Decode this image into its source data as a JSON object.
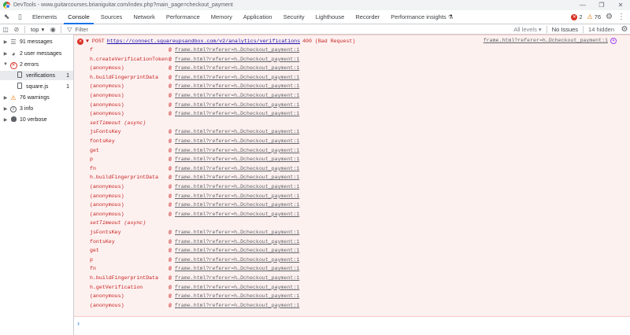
{
  "window": {
    "title": "DevTools - www.guitarcourses.brianiguitar.com/index.php?main_page=checkout_payment",
    "buttons": [
      "—",
      "❐",
      "✕"
    ]
  },
  "tabs": [
    "Elements",
    "Console",
    "Sources",
    "Network",
    "Performance",
    "Memory",
    "Application",
    "Security",
    "Lighthouse",
    "Recorder",
    "Performance insights"
  ],
  "active_tab": "Console",
  "badges": {
    "errors": "2",
    "warnings": "76"
  },
  "toolbar": {
    "context": "top",
    "filter_placeholder": "Filter",
    "levels": "All levels ▾",
    "issues": "No Issues",
    "hidden": "14 hidden"
  },
  "sidebar": {
    "items": [
      {
        "label": "91 messages",
        "num": ""
      },
      {
        "label": "2 user messages",
        "num": ""
      },
      {
        "label": "2 errors",
        "num": ""
      },
      {
        "label": "verifications",
        "num": "1"
      },
      {
        "label": "square.js",
        "num": "1"
      },
      {
        "label": "76 warnings",
        "num": ""
      },
      {
        "label": "3 info",
        "num": ""
      },
      {
        "label": "10 verbose",
        "num": ""
      }
    ]
  },
  "error": {
    "method": "▼ POST",
    "url": "https://connect.squareupsandbox.com/v2/analytics/verifications",
    "status": "400 (Bad Request)",
    "source": "frame.html?referer=h…Dcheckout_payment:1",
    "frames": [
      {
        "fn": "f",
        "loc": "frame.html?referer=h…Dcheckout_payment:1"
      },
      {
        "fn": "h.createVerificationToken",
        "loc": "frame.html?referer=h…Dcheckout_payment:1"
      },
      {
        "fn": "(anonymous)",
        "loc": "frame.html?referer=h…Dcheckout_payment:1"
      },
      {
        "fn": "h.buildFingerprintData",
        "loc": "frame.html?referer=h…Dcheckout_payment:1"
      },
      {
        "fn": "(anonymous)",
        "loc": "frame.html?referer=h…Dcheckout_payment:1"
      },
      {
        "fn": "(anonymous)",
        "loc": "frame.html?referer=h…Dcheckout_payment:1"
      },
      {
        "fn": "(anonymous)",
        "loc": "frame.html?referer=h…Dcheckout_payment:1"
      },
      {
        "fn": "(anonymous)",
        "loc": "frame.html?referer=h…Dcheckout_payment:1"
      },
      {
        "fn": "setTimeout (async)",
        "loc": "",
        "async": true
      },
      {
        "fn": "jsFontsKey",
        "loc": "frame.html?referer=h…Dcheckout_payment:1"
      },
      {
        "fn": "fontsKey",
        "loc": "frame.html?referer=h…Dcheckout_payment:1"
      },
      {
        "fn": "get",
        "loc": "frame.html?referer=h…Dcheckout_payment:1"
      },
      {
        "fn": "p",
        "loc": "frame.html?referer=h…Dcheckout_payment:1"
      },
      {
        "fn": "fn",
        "loc": "frame.html?referer=h…Dcheckout_payment:1"
      },
      {
        "fn": "h.buildFingerprintData",
        "loc": "frame.html?referer=h…Dcheckout_payment:1"
      },
      {
        "fn": "(anonymous)",
        "loc": "frame.html?referer=h…Dcheckout_payment:1"
      },
      {
        "fn": "(anonymous)",
        "loc": "frame.html?referer=h…Dcheckout_payment:1"
      },
      {
        "fn": "(anonymous)",
        "loc": "frame.html?referer=h…Dcheckout_payment:1"
      },
      {
        "fn": "(anonymous)",
        "loc": "frame.html?referer=h…Dcheckout_payment:1"
      },
      {
        "fn": "setTimeout (async)",
        "loc": "",
        "async": true
      },
      {
        "fn": "jsFontsKey",
        "loc": "frame.html?referer=h…Dcheckout_payment:1"
      },
      {
        "fn": "fontsKey",
        "loc": "frame.html?referer=h…Dcheckout_payment:1"
      },
      {
        "fn": "get",
        "loc": "frame.html?referer=h…Dcheckout_payment:1"
      },
      {
        "fn": "p",
        "loc": "frame.html?referer=h…Dcheckout_payment:1"
      },
      {
        "fn": "fn",
        "loc": "frame.html?referer=h…Dcheckout_payment:1"
      },
      {
        "fn": "h.buildFingerprintData",
        "loc": "frame.html?referer=h…Dcheckout_payment:1"
      },
      {
        "fn": "h.getVerification",
        "loc": "frame.html?referer=h…Dcheckout_payment:1"
      },
      {
        "fn": "(anonymous)",
        "loc": "frame.html?referer=h…Dcheckout_payment:1"
      },
      {
        "fn": "(anonymous)",
        "loc": "frame.html?referer=h…Dcheckout_payment:1"
      }
    ]
  },
  "prompt": "›",
  "colors": {
    "accent": "#1a73e8",
    "error": "#d93025",
    "error_bg": "#fdf1f0",
    "warning": "#e37400"
  }
}
